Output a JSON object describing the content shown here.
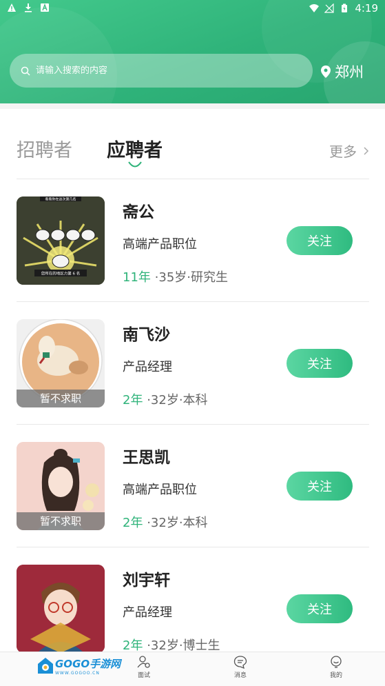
{
  "status_bar": {
    "time": "4:19"
  },
  "search": {
    "placeholder": "请输入搜索的内容"
  },
  "location": {
    "city": "郑州"
  },
  "tabs": [
    {
      "label": "招聘者",
      "active": false
    },
    {
      "label": "应聘者",
      "active": true
    }
  ],
  "more_label": "更多",
  "follow_label": "关注",
  "candidates": [
    {
      "name": "斋公",
      "position": "高端产品职位",
      "years": "11年",
      "details": "·35岁·研究生",
      "tag": ""
    },
    {
      "name": "南飞沙",
      "position": "产品经理",
      "years": "2年",
      "details": "·32岁·本科",
      "tag": "暂不求职"
    },
    {
      "name": "王思凯",
      "position": "高端产品职位",
      "years": "2年",
      "details": "·32岁·本科",
      "tag": "暂不求职"
    },
    {
      "name": "刘宇轩",
      "position": "产品经理",
      "years": "2年",
      "details": "·32岁·博士生",
      "tag": ""
    }
  ],
  "avatar1_texts": {
    "top": "看看你在这次第几名",
    "bottom": "您所在的地区力第 6 名"
  },
  "bottom_nav": {
    "logo_text": "GOGO手游网",
    "logo_sub": "WWW.GOGOO.CN",
    "items": [
      {
        "label": "面试",
        "icon": "interview-icon"
      },
      {
        "label": "消息",
        "icon": "message-icon"
      },
      {
        "label": "我的",
        "icon": "profile-icon"
      }
    ]
  },
  "colors": {
    "accent": "#2fb37a",
    "header_start": "#43c98c",
    "header_end": "#27a56f"
  }
}
